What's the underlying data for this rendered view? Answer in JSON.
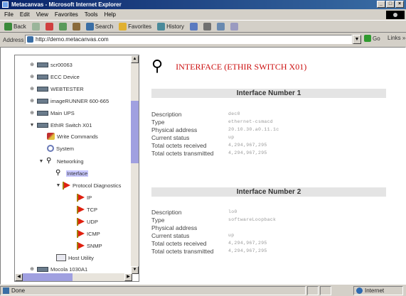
{
  "window": {
    "title": "Metacanvas - Microsoft Internet Explorer",
    "controls": [
      "_",
      "□",
      "×"
    ]
  },
  "menubar": {
    "items": [
      "File",
      "Edit",
      "View",
      "Favorites",
      "Tools",
      "Help"
    ]
  },
  "toolbar": {
    "back": "Back",
    "search": "Search",
    "favorites": "Favorites",
    "history": "History"
  },
  "address": {
    "label": "Address",
    "url": "http://demo.metacanvas.com",
    "go": "Go",
    "links": "Links »"
  },
  "tree": {
    "items": [
      {
        "label": "scr00063"
      },
      {
        "label": "ECC Device"
      },
      {
        "label": "WEBTESTER"
      },
      {
        "label": "imageRUNNER 600-665"
      },
      {
        "label": "Main UPS"
      },
      {
        "label": "EthIR Switch X01"
      },
      {
        "label": "Write Commands"
      },
      {
        "label": "System"
      },
      {
        "label": "Networking"
      },
      {
        "label": "Interface"
      },
      {
        "label": "Protocol Diagnostics"
      },
      {
        "label": "IP"
      },
      {
        "label": "TCP"
      },
      {
        "label": "UDP"
      },
      {
        "label": "ICMP"
      },
      {
        "label": "SNMP"
      },
      {
        "label": "Host Utility"
      },
      {
        "label": "Mocola 1030A1"
      }
    ]
  },
  "detail": {
    "title": "INTERFACE (ETHIR SWITCH X01)",
    "sections": [
      {
        "heading": "Interface Number 1",
        "rows": [
          {
            "key": "Description",
            "value": "dec0"
          },
          {
            "key": "Type",
            "value": "ethernet-csmacd"
          },
          {
            "key": "Physical address",
            "value": "20.10.30.a0.11.1c"
          },
          {
            "key": "Current status",
            "value": "up"
          },
          {
            "key": "Total octets received",
            "value": "4,294,967,295"
          },
          {
            "key": "Total octets transmitted",
            "value": "4,294,967,295"
          }
        ]
      },
      {
        "heading": "Interface Number 2",
        "rows": [
          {
            "key": "Description",
            "value": "lo0"
          },
          {
            "key": "Type",
            "value": "softwareLoopback"
          },
          {
            "key": "Physical address",
            "value": ""
          },
          {
            "key": "Current status",
            "value": "up"
          },
          {
            "key": "Total octets received",
            "value": "4,294,967,295"
          },
          {
            "key": "Total octets transmitted",
            "value": "4,294,967,295"
          }
        ]
      }
    ]
  },
  "status": {
    "text": "Done",
    "zone": "Internet"
  }
}
